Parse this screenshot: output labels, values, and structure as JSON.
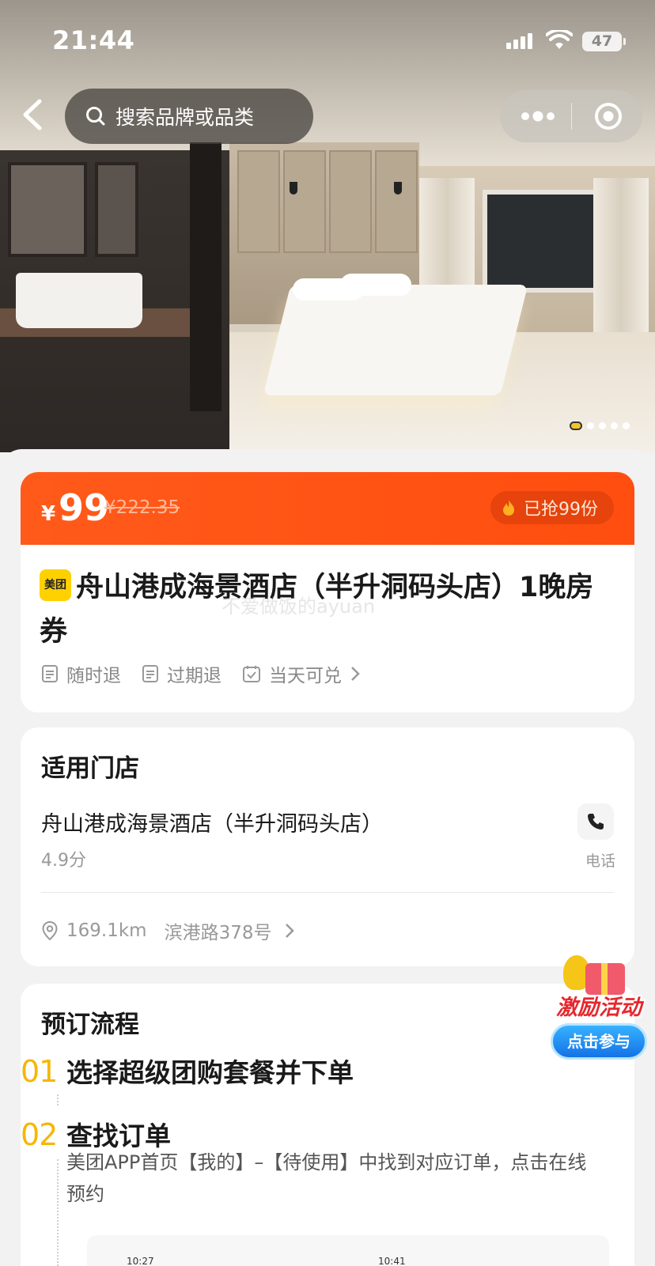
{
  "status_bar": {
    "time": "21:44",
    "battery": "47"
  },
  "header": {
    "search_placeholder": "搜索品牌或品类"
  },
  "carousel": {
    "total": 5,
    "active_index": 0
  },
  "deal": {
    "currency": "¥",
    "price": "99",
    "original_price": "¥222.35",
    "sold_label": "已抢99份",
    "platform_badge": "美团",
    "title": "舟山港成海景酒店（半升洞码头店）1晚房券",
    "watermark": "不爱做饭的ayuan",
    "tags": [
      "随时退",
      "过期退",
      "当天可兑"
    ]
  },
  "store": {
    "section_title": "适用门店",
    "name": "舟山港成海景酒店（半升洞码头店）",
    "rating": "4.9分",
    "phone_label": "电话",
    "distance": "169.1km",
    "address": "滨港路378号"
  },
  "flow": {
    "section_title": "预订流程",
    "steps": [
      {
        "num": "01",
        "title": "选择超级团购套餐并下单"
      },
      {
        "num": "02",
        "title": "查找订单",
        "desc": "美团APP首页【我的】–【待使用】中找到对应订单，点击在线预约"
      }
    ],
    "thumb_times": [
      "10:27",
      "10:41"
    ]
  },
  "promo": {
    "title": "激励活动",
    "button": "点击参与"
  },
  "colors": {
    "accent": "#ff4e0f",
    "step_number": "#f6b600",
    "badge_yellow": "#ffd100"
  }
}
